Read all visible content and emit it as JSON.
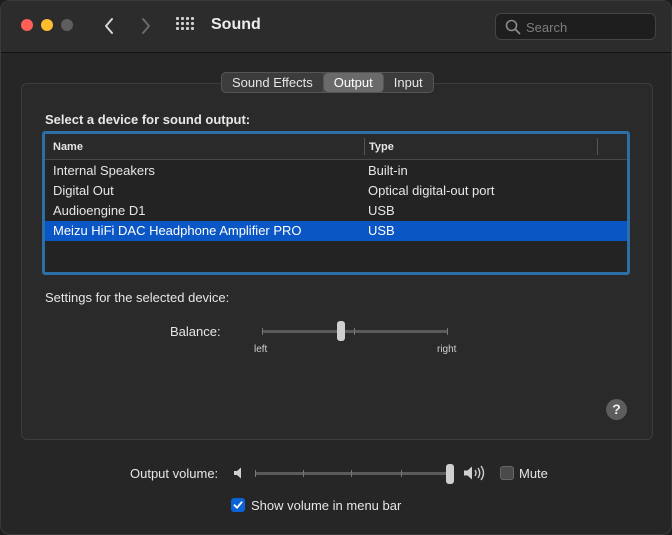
{
  "window": {
    "title": "Sound",
    "search_placeholder": "Search",
    "nav_back_icon": "chevron-left",
    "nav_forward_icon": "chevron-right",
    "grid_icon": "show-all-grid"
  },
  "tabs": [
    {
      "label": "Sound Effects",
      "active": false
    },
    {
      "label": "Output",
      "active": true
    },
    {
      "label": "Input",
      "active": false
    }
  ],
  "output": {
    "heading": "Select a device for sound output:",
    "columns": [
      "Name",
      "Type"
    ],
    "devices": [
      {
        "name": "Internal Speakers",
        "type": "Built-in",
        "selected": false
      },
      {
        "name": "Digital Out",
        "type": "Optical digital-out port",
        "selected": false
      },
      {
        "name": "Audioengine D1",
        "type": "USB",
        "selected": false
      },
      {
        "name": "Meizu HiFi DAC Headphone Amplifier PRO",
        "type": "USB",
        "selected": true
      }
    ],
    "settings_label": "Settings for the selected device:",
    "balance_label": "Balance:",
    "balance_left": "left",
    "balance_right": "right",
    "balance_value": 0.42,
    "help_label": "?"
  },
  "volume": {
    "label": "Output volume:",
    "value": 1.0,
    "mute_label": "Mute",
    "mute_checked": false,
    "show_in_menu_label": "Show volume in menu bar",
    "show_in_menu_checked": true
  },
  "colors": {
    "selection": "#0a56c4",
    "focus_ring": "#2c6ea6",
    "close": "#fe5f57",
    "minimize": "#febc2e",
    "checkbox_on": "#0a64d6"
  }
}
